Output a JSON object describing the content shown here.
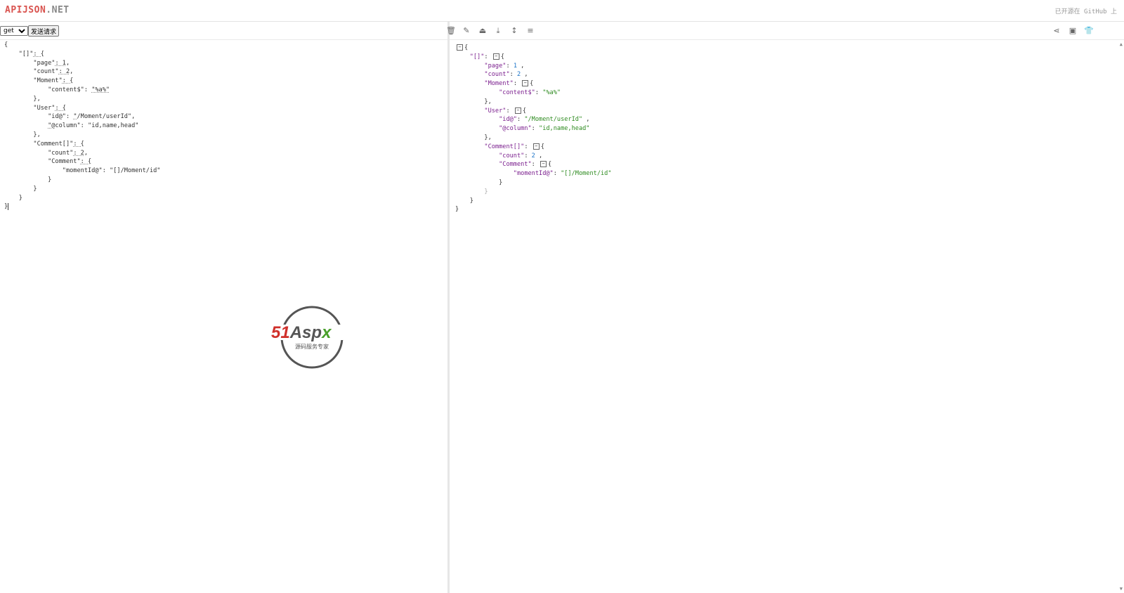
{
  "header": {
    "logo_main": "APIJSON",
    "logo_suffix": ".NET",
    "right_text": "已开源在 GitHub 上"
  },
  "left": {
    "method_value": "get",
    "send_label": "发送请求"
  },
  "right": {
    "toolbar_icons": [
      "trash-icon",
      "magic-wand-icon",
      "upload-icon",
      "download-icon",
      "expand-lines-icon",
      "collapse-lines-icon",
      "share-icon",
      "save-icon",
      "shirt-icon"
    ]
  },
  "watermark": {
    "brand": "51Aspx",
    "tagline": "源码服务专家"
  }
}
